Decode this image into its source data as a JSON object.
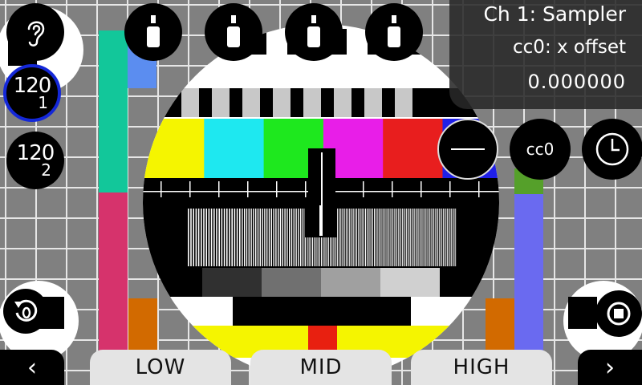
{
  "header": {
    "channel": "Ch 1: Sampler",
    "control": "cc0: x offset",
    "value": "0.000000"
  },
  "programs": [
    {
      "number": "120",
      "sub": "1",
      "selected": true
    },
    {
      "number": "120",
      "sub": "2",
      "selected": false
    }
  ],
  "cc_button": {
    "label": "cc0"
  },
  "tabs": [
    {
      "label": "LOW"
    },
    {
      "label": "MID"
    },
    {
      "label": "HIGH"
    }
  ],
  "nav": {
    "prev": "‹",
    "next": "›"
  },
  "icons": {
    "top": [
      "jack-icon",
      "jack-icon",
      "jack-icon",
      "jack-icon"
    ],
    "listen": "ear-icon",
    "reset": "reset-icon",
    "stop": "stop-icon",
    "clock": "clock-icon",
    "line": "line-icon"
  },
  "colors": {
    "selected_ring": "#1428d8",
    "info_panel": "#282828",
    "tab_bg": "#e4e4e4",
    "test_bars": [
      "#f5f500",
      "#1ee8f0",
      "#1ee81e",
      "#e81ee8",
      "#e81e1e",
      "#2020e8"
    ]
  }
}
